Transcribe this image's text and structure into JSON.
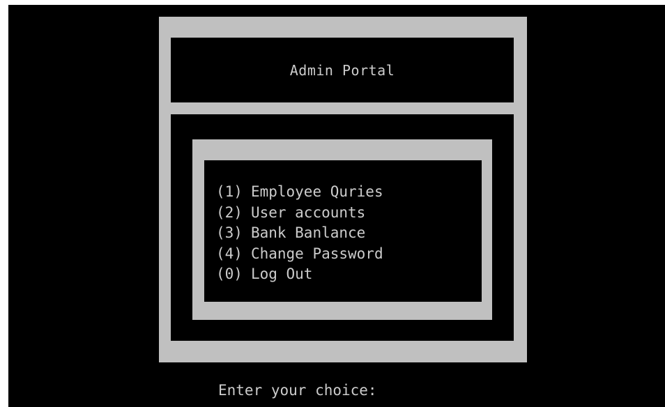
{
  "colors": {
    "background": "#000000",
    "frame": "#c0c0c0",
    "text": "#cccccc"
  },
  "header": {
    "title": "Admin Portal"
  },
  "menu": {
    "items": [
      {
        "key": "(1)",
        "label": "Employee Quries"
      },
      {
        "key": "(2)",
        "label": "User accounts"
      },
      {
        "key": "(3)",
        "label": "Bank Banlance"
      },
      {
        "key": "(4)",
        "label": "Change Password"
      },
      {
        "key": "(0)",
        "label": "Log Out"
      }
    ]
  },
  "prompt": {
    "label": "Enter your choice:"
  }
}
